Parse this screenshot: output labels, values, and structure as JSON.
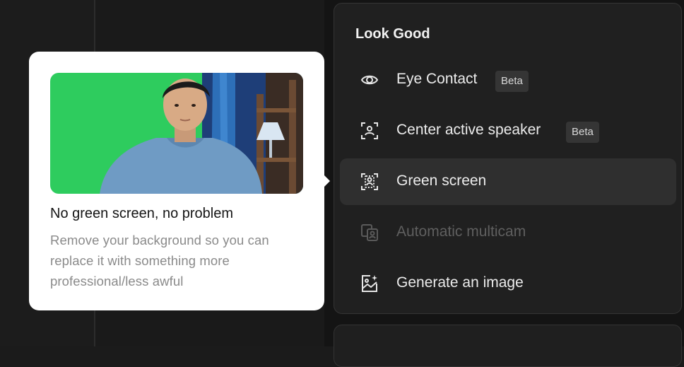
{
  "tooltip": {
    "title": "No green screen, no problem",
    "description": "Remove your background so you can replace it with something more professional/less awful",
    "image_alt": "Person in front of a green screen background"
  },
  "menu": {
    "section_title": "Look Good",
    "items": [
      {
        "label": "Eye Contact",
        "icon": "eye-icon",
        "badge": "Beta",
        "state": "normal"
      },
      {
        "label": "Center active speaker",
        "icon": "person-focus-icon",
        "badge": "Beta",
        "state": "normal"
      },
      {
        "label": "Green screen",
        "icon": "person-screen-icon",
        "badge": "",
        "state": "active"
      },
      {
        "label": "Automatic multicam",
        "icon": "multicam-icon",
        "badge": "",
        "state": "disabled"
      },
      {
        "label": "Generate an image",
        "icon": "image-sparkle-icon",
        "badge": "",
        "state": "normal"
      }
    ]
  },
  "colors": {
    "accent_green": "#2ecc5e",
    "panel_bg": "#202020",
    "active_item_bg": "#2f2f2f",
    "badge_bg": "#353535"
  }
}
